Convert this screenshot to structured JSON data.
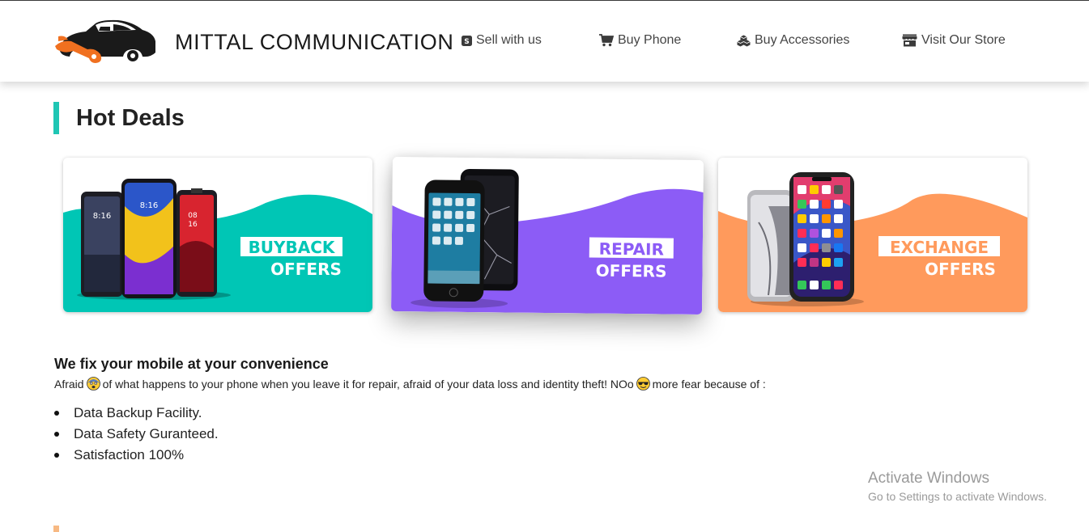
{
  "header": {
    "brand": "MITTAL COMMUNICATION",
    "nav": [
      {
        "label": "Sell with us",
        "icon": "skype-square-icon"
      },
      {
        "label": "Buy Phone",
        "icon": "cart-icon"
      },
      {
        "label": "Buy Accessories",
        "icon": "cubes-icon"
      },
      {
        "label": "Visit Our Store",
        "icon": "store-icon"
      }
    ]
  },
  "deals": {
    "title": "Hot Deals",
    "cards": [
      {
        "top": "BUYBACK",
        "bottom": "OFFERS",
        "color": "#00c6b5"
      },
      {
        "top": "REPAIR",
        "bottom": "OFFERS",
        "color": "#8c5cf6"
      },
      {
        "top": "EXCHANGE",
        "bottom": "OFFERS",
        "color": "#ff9a5c"
      }
    ]
  },
  "info": {
    "title": "We fix your mobile at your convenience",
    "desc_part1": "Afraid",
    "desc_part2": " of what happens to your phone when you leave it for repair, afraid of your data loss and identity theft! NOo",
    "desc_part3": " more fear because of :",
    "features": [
      "Data Backup Facility.",
      "Data Safety Guranteed.",
      "Satisfaction 100%"
    ]
  },
  "watermark": {
    "line1": "Activate Windows",
    "line2": "Go to Settings to activate Windows."
  },
  "colors": {
    "accent": "#1fc6b4",
    "teal": "#00c6b5",
    "purple": "#8c5cf6",
    "orange": "#ff9a5c"
  }
}
